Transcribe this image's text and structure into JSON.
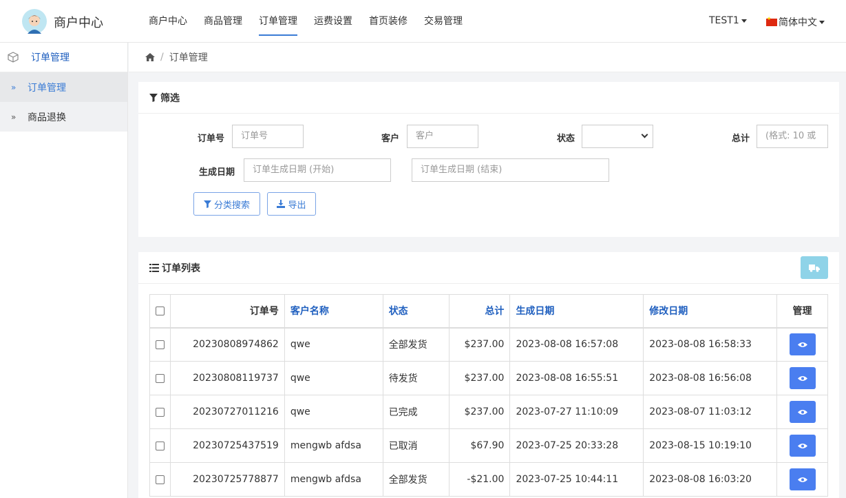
{
  "header": {
    "brand": "商户中心",
    "nav": [
      {
        "label": "商户中心",
        "active": false
      },
      {
        "label": "商品管理",
        "active": false
      },
      {
        "label": "订单管理",
        "active": true
      },
      {
        "label": "运费设置",
        "active": false
      },
      {
        "label": "首页装修",
        "active": false
      },
      {
        "label": "交易管理",
        "active": false
      }
    ],
    "user": "TEST1",
    "language": "简体中文"
  },
  "sidebar": {
    "title": "订单管理",
    "items": [
      {
        "label": "订单管理",
        "active": true
      },
      {
        "label": "商品退换",
        "active": false
      }
    ]
  },
  "breadcrumb": {
    "current": "订单管理"
  },
  "filter": {
    "title": "筛选",
    "order_no_label": "订单号",
    "order_no_placeholder": "订单号",
    "customer_label": "客户",
    "customer_placeholder": "客户",
    "status_label": "状态",
    "status_value": "",
    "total_label": "总计",
    "total_placeholder": "(格式: 10 或",
    "date_label": "生成日期",
    "date_start_placeholder": "订单生成日期 (开始)",
    "date_end_placeholder": "订单生成日期 (结束)",
    "search_button": "分类搜索",
    "export_button": "导出"
  },
  "list": {
    "title": "订单列表",
    "columns": [
      "订单号",
      "客户名称",
      "状态",
      "总计",
      "生成日期",
      "修改日期",
      "管理"
    ],
    "rows": [
      {
        "order_no": "20230808974862",
        "customer": "qwe",
        "status": "全部发货",
        "total": "$237.00",
        "created": "2023-08-08 16:57:08",
        "modified": "2023-08-08 16:58:33"
      },
      {
        "order_no": "20230808119737",
        "customer": "qwe",
        "status": "待发货",
        "total": "$237.00",
        "created": "2023-08-08 16:55:51",
        "modified": "2023-08-08 16:56:08"
      },
      {
        "order_no": "20230727011216",
        "customer": "qwe",
        "status": "已完成",
        "total": "$237.00",
        "created": "2023-07-27 11:10:09",
        "modified": "2023-08-07 11:03:12"
      },
      {
        "order_no": "20230725437519",
        "customer": "mengwb afdsa",
        "status": "已取消",
        "total": "$67.90",
        "created": "2023-07-25 20:33:28",
        "modified": "2023-08-15 10:19:10"
      },
      {
        "order_no": "20230725778877",
        "customer": "mengwb afdsa",
        "status": "全部发货",
        "total": "-$21.00",
        "created": "2023-07-25 10:44:11",
        "modified": "2023-08-08 16:03:20"
      }
    ]
  },
  "colors": {
    "accent": "#3a7bd5",
    "link": "#1f5fbf",
    "view_button": "#4a7ef0",
    "truck_button": "#8fd3e8"
  }
}
